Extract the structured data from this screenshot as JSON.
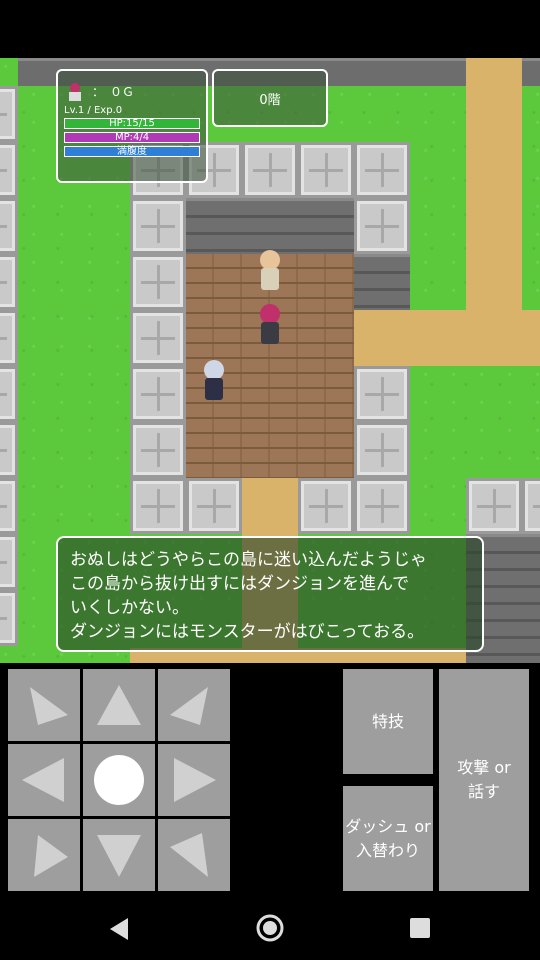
{
  "hud": {
    "gold": "：　０Ｇ",
    "level_exp": "Lv.1 / Exp.0",
    "hp": "HP:15/15",
    "mp": "MP:4/4",
    "hunger": "満腹度",
    "floor": "0階"
  },
  "message": {
    "lines": [
      "おぬしはどうやらこの島に迷い込んだようじゃ",
      "この島から抜け出すにはダンジョンを進んで",
      "いくしかない。",
      "ダンジョンにはモンスターがはびこっておる。"
    ]
  },
  "buttons": {
    "skill": "特技",
    "dash_line1": "ダッシュ or",
    "dash_line2": "入替わり",
    "attack_line1": "攻撃 or",
    "attack_line2": "話す"
  },
  "dpad": {
    "keys": [
      "up-left",
      "up",
      "up-right",
      "left",
      "center",
      "right",
      "down-left",
      "down",
      "down-right"
    ]
  },
  "colors": {
    "grass": "#5cc93c",
    "sand": "#d9b36a",
    "hp_bar": "#33b53a",
    "mp_bar": "#b03ab5",
    "hunger_bar": "#2f7fd6",
    "button": "#9e9e9e"
  },
  "nav": {
    "back": "back-icon",
    "home": "home-icon",
    "recents": "recents-icon"
  }
}
